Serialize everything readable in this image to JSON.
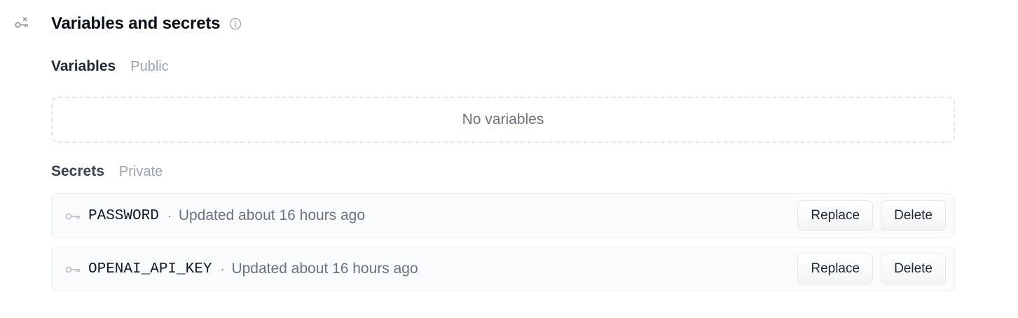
{
  "section": {
    "title": "Variables and secrets",
    "icon": "key-off-icon",
    "info_icon": "info-icon"
  },
  "variables": {
    "label": "Variables",
    "tag": "Public",
    "empty_text": "No variables"
  },
  "secrets": {
    "label": "Secrets",
    "tag": "Private",
    "separator": "·",
    "items": [
      {
        "name": "PASSWORD",
        "updated": "Updated about 16 hours ago",
        "replace_label": "Replace",
        "delete_label": "Delete"
      },
      {
        "name": "OPENAI_API_KEY",
        "updated": "Updated about 16 hours ago",
        "replace_label": "Replace",
        "delete_label": "Delete"
      }
    ]
  },
  "colors": {
    "text_primary": "#111827",
    "text_muted": "#6b7280",
    "tag": "#9ca3af",
    "border": "#e5e7eb"
  }
}
